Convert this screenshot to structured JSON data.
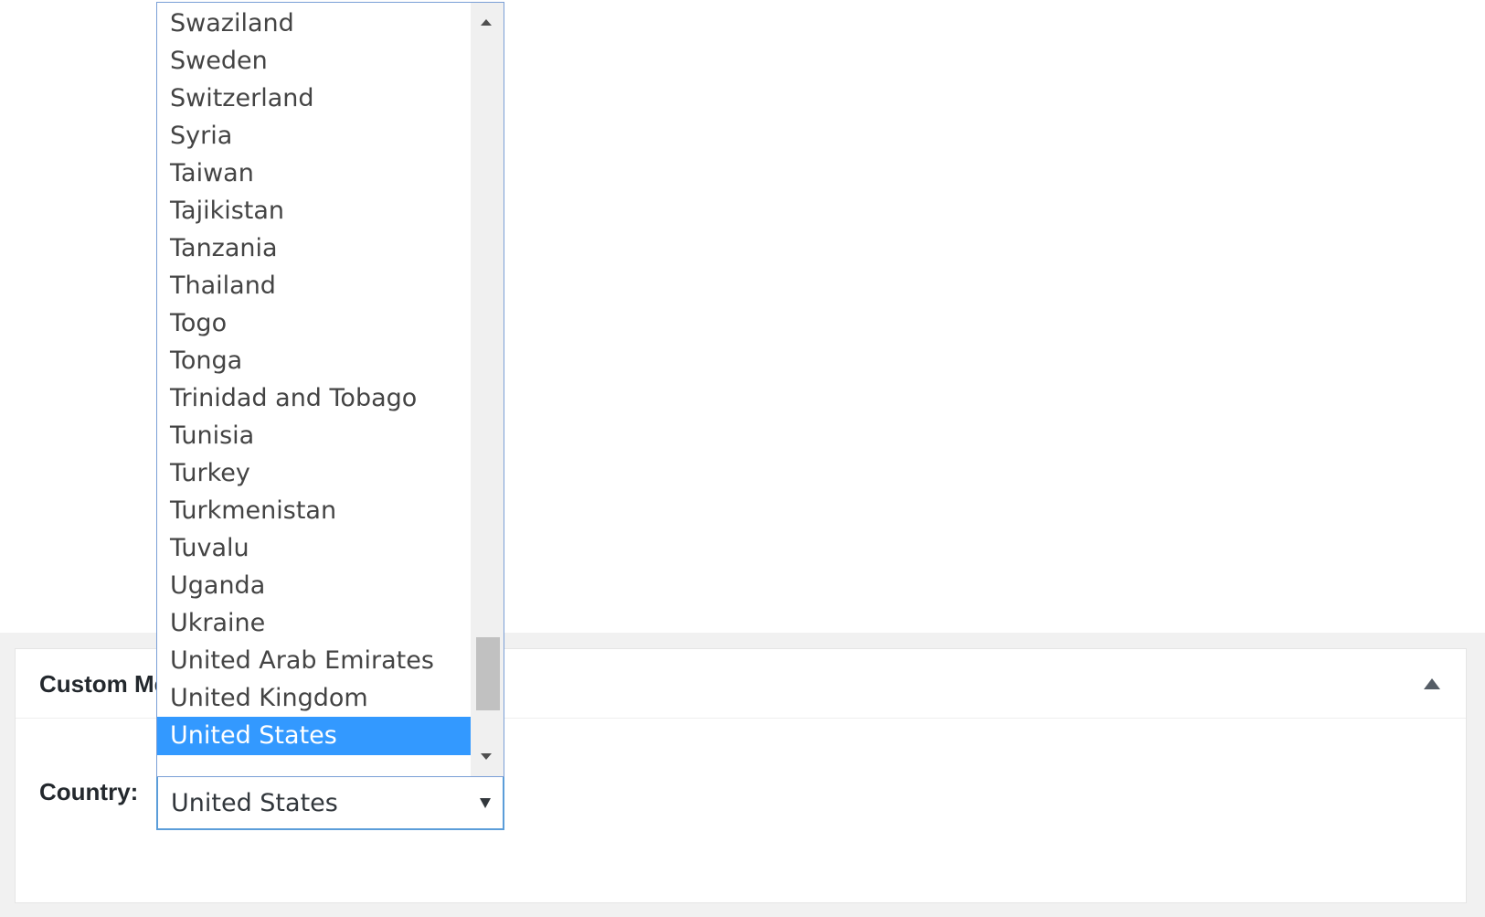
{
  "metabox": {
    "title": "Custom Meta",
    "toggle_icon": "triangle-up-icon"
  },
  "country_field": {
    "label": "Country:",
    "selected_value": "United States",
    "arrow_icon": "dropdown-arrow-icon"
  },
  "dropdown": {
    "options": [
      "Swaziland",
      "Sweden",
      "Switzerland",
      "Syria",
      "Taiwan",
      "Tajikistan",
      "Tanzania",
      "Thailand",
      "Togo",
      "Tonga",
      "Trinidad and Tobago",
      "Tunisia",
      "Turkey",
      "Turkmenistan",
      "Tuvalu",
      "Uganda",
      "Ukraine",
      "United Arab Emirates",
      "United Kingdom",
      "United States"
    ],
    "selected_index": 19,
    "highlight_color": "#3399ff"
  }
}
